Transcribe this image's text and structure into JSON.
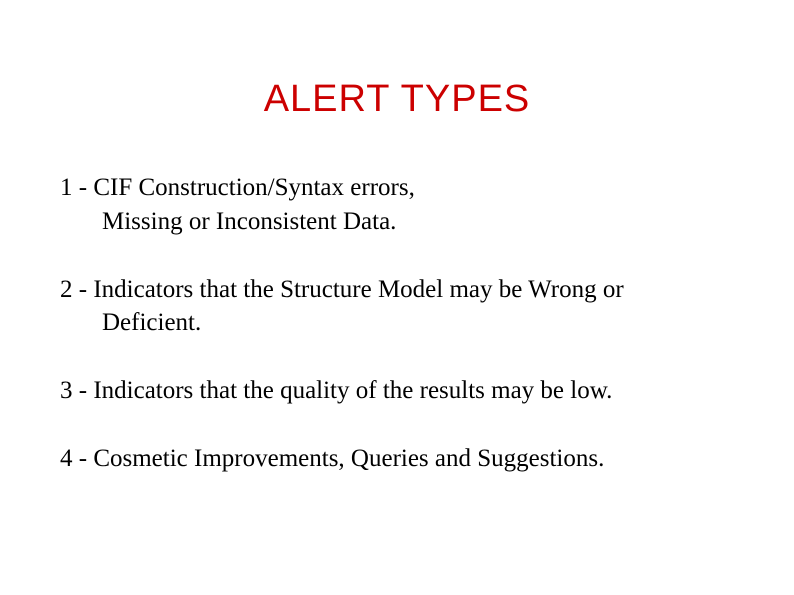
{
  "title": "ALERT TYPES",
  "items": [
    {
      "line1": "1 - CIF Construction/Syntax errors,",
      "line2": "Missing or Inconsistent Data."
    },
    {
      "line1": "2 - Indicators that the Structure Model may be Wrong or",
      "line2": "Deficient."
    },
    {
      "line1": "3 - Indicators that the quality of the results may be low.",
      "line2": ""
    },
    {
      "line1": "4 - Cosmetic Improvements, Queries and Suggestions.",
      "line2": ""
    }
  ]
}
